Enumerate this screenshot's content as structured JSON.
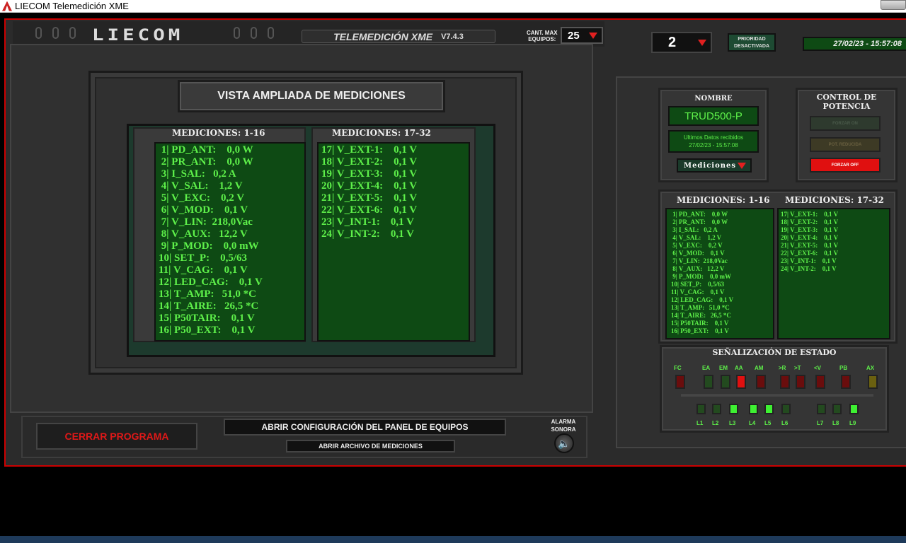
{
  "window": {
    "title": "LIECOM Telemedición XME"
  },
  "header": {
    "logo_text": "LIECOM",
    "app_name": "TELEMEDICIÓN XME",
    "version": "V7.4.3",
    "cant_max_label_1": "CANT. MAX",
    "cant_max_label_2": "EQUIPOS:",
    "cant_max_value": "25",
    "equipo_value": "2",
    "prioridad_line1": "PRIORIDAD",
    "prioridad_line2": "DESACTIVADA",
    "datetime": "27/02/23 - 15:57:08"
  },
  "vista": {
    "title": "VISTA AMPLIADA DE MEDICIONES",
    "col1_header": "MEDICIONES: 1-16",
    "col2_header": "MEDICIONES: 17-32",
    "col1": [
      " 1| PD_ANT:    0,0 W",
      " 2| PR_ANT:    0,0 W",
      " 3| I_SAL:   0,2 A",
      " 4| V_SAL:    1,2 V",
      " 5| V_EXC:    0,2 V",
      " 6| V_MOD:    0,1 V",
      " 7| V_LIN:  218,0Vac",
      " 8| V_AUX:   12,2 V",
      " 9| P_MOD:    0,0 mW",
      "10| SET_P:    0,5/63",
      "11| V_CAG:    0,1 V",
      "12| LED_CAG:    0,1 V",
      "13| T_AMP:   51,0 *C",
      "14| T_AIRE:   26,5 *C",
      "15| P50TAIR:    0,1 V",
      "16| P50_EXT:    0,1 V"
    ],
    "col2": [
      "17| V_EXT-1:    0,1 V",
      "18| V_EXT-2:    0,1 V",
      "19| V_EXT-3:    0,1 V",
      "20| V_EXT-4:    0,1 V",
      "21| V_EXT-5:    0,1 V",
      "22| V_EXT-6:    0,1 V",
      "23| V_INT-1:    0,1 V",
      "24| V_INT-2:    0,1 V"
    ]
  },
  "bottom": {
    "cerrar": "CERRAR PROGRAMA",
    "abrir_config": "ABRIR CONFIGURACIÓN DEL PANEL DE EQUIPOS",
    "abrir_archivo": "ABRIR ARCHIVO DE MEDICIONES",
    "alarma_1": "ALARMA",
    "alarma_2": "SONORA"
  },
  "right": {
    "nombre_label": "NOMBRE",
    "nombre_value": "TRUD500-P",
    "ultimos_1": "Ultimos Datos recibidos",
    "ultimos_2": "27/02/23 - 15:57:08",
    "mediciones_select": "Mediciones",
    "control_1": "CONTROL DE",
    "control_2": "POTENCIA",
    "forzar_on": "FORZAR ON",
    "pot_reducida": "POT. REDUCIDA",
    "forzar_off": "FORZAR OFF",
    "col1_header": "MEDICIONES: 1-16",
    "col2_header": "MEDICIONES: 17-32",
    "col1": [
      " 1| PD_ANT:    0,0 W",
      " 2| PR_ANT:    0,0 W",
      " 3| I_SAL:   0,2 A",
      " 4| V_SAL:    1,2 V",
      " 5| V_EXC:    0,2 V",
      " 6| V_MOD:    0,1 V",
      " 7| V_LIN:  218,0Vac",
      " 8| V_AUX:   12,2 V",
      " 9| P_MOD:    0,0 mW",
      "10| SET_P:    0,5/63",
      "11| V_CAG:    0,1 V",
      "12| LED_CAG:    0,1 V",
      "13| T_AMP:   51,0 *C",
      "14| T_AIRE:   26,5 *C",
      "15| P50TAIR:    0,1 V",
      "16| P50_EXT:    0,1 V"
    ],
    "col2": [
      "17| V_EXT-1:    0,1 V",
      "18| V_EXT-2:    0,1 V",
      "19| V_EXT-3:    0,1 V",
      "20| V_EXT-4:    0,1 V",
      "21| V_EXT-5:    0,1 V",
      "22| V_EXT-6:    0,1 V",
      "23| V_INT-1:    0,1 V",
      "24| V_INT-2:    0,1 V"
    ],
    "senal_title": "SEÑALIZACIÓN DE ESTADO",
    "status_leds": [
      {
        "label": "FC",
        "color": "#6a0d0d"
      },
      {
        "label": "EA",
        "color": "#234a1f"
      },
      {
        "label": "EM",
        "color": "#234a1f"
      },
      {
        "label": "AA",
        "color": "#e01010"
      },
      {
        "label": "AM",
        "color": "#6a0d0d"
      },
      {
        "label": ">R",
        "color": "#6a0d0d"
      },
      {
        "label": ">T",
        "color": "#6a0d0d"
      },
      {
        "label": "<V",
        "color": "#6a0d0d"
      },
      {
        "label": "PB",
        "color": "#6a0d0d"
      },
      {
        "label": "AX",
        "color": "#6a6010"
      }
    ],
    "l_leds": [
      {
        "label": "L1",
        "color": "#234a1f"
      },
      {
        "label": "L2",
        "color": "#234a1f"
      },
      {
        "label": "L3",
        "color": "#3ef032"
      },
      {
        "label": "L4",
        "color": "#3ef032"
      },
      {
        "label": "L5",
        "color": "#3ef032"
      },
      {
        "label": "L6",
        "color": "#234a1f"
      },
      {
        "label": "L7",
        "color": "#234a1f"
      },
      {
        "label": "L8",
        "color": "#234a1f"
      },
      {
        "label": "L9",
        "color": "#3ef032"
      }
    ]
  }
}
